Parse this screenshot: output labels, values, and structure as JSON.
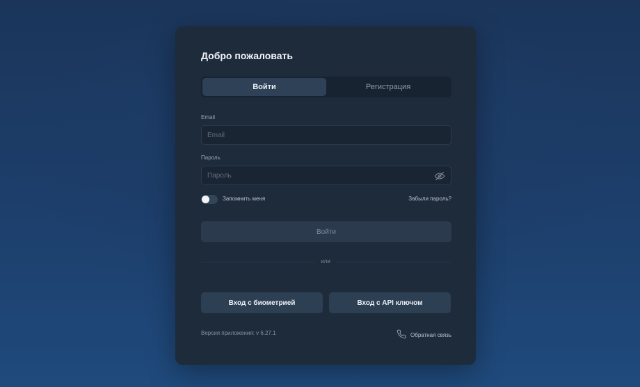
{
  "login": {
    "title": "Добро пожаловать",
    "tabs": [
      {
        "label": "Войти",
        "active": true
      },
      {
        "label": "Регистрация",
        "active": false
      }
    ],
    "email": {
      "label": "Email",
      "placeholder": "Email",
      "value": ""
    },
    "password": {
      "label": "Пароль",
      "placeholder": "Пароль",
      "value": "",
      "visibility_icon": "eye-off-icon"
    },
    "remember_me": {
      "label": "Запомнить меня",
      "checked": false
    },
    "forgot_password": "Забыли пароль?",
    "submit_label": "Войти",
    "divider_text": "или",
    "biometric_label": "Вход с биометрией",
    "api_key_label": "Вход с API ключом",
    "version_text": "Версия приложения: v 6.27.1",
    "feedback": {
      "label": "Обратная связь",
      "icon": "phone-icon"
    }
  },
  "colors": {
    "background": "#1d3f6c",
    "card": "#1e2b3b",
    "tab_active": "#2e4156",
    "button_alt": "#2d3f53"
  }
}
